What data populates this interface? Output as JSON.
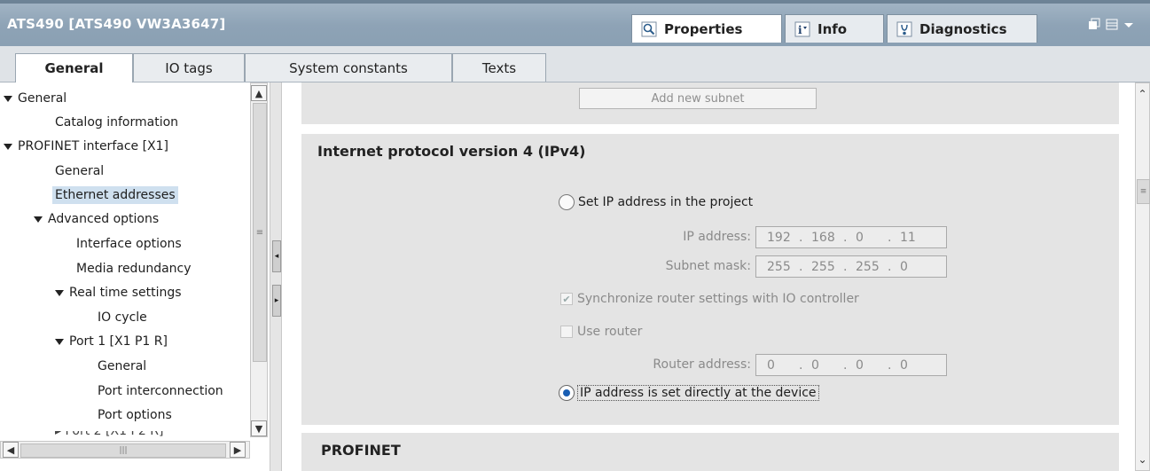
{
  "window": {
    "title": "ATS490 [ATS490 VW3A3647]",
    "tabs": [
      {
        "label": "Properties",
        "icon": "properties-magnifier-icon",
        "active": true
      },
      {
        "label": "Info",
        "icon": "info-icon",
        "active": false
      },
      {
        "label": "Diagnostics",
        "icon": "diagnostics-icon",
        "active": false
      }
    ],
    "window_controls_icon": "window-layout-icons"
  },
  "sub_tabs": [
    {
      "label": "General",
      "active": true
    },
    {
      "label": "IO tags",
      "active": false
    },
    {
      "label": "System constants",
      "active": false
    },
    {
      "label": "Texts",
      "active": false
    }
  ],
  "tree": [
    {
      "label": "General",
      "expanded": true,
      "level": 0
    },
    {
      "label": "Catalog information",
      "level": 1
    },
    {
      "label": "PROFINET interface [X1]",
      "expanded": true,
      "level": 0
    },
    {
      "label": "General",
      "level": 1
    },
    {
      "label": "Ethernet addresses",
      "level": 1,
      "selected": true
    },
    {
      "label": "Advanced options",
      "expanded": true,
      "level": 1
    },
    {
      "label": "Interface options",
      "level": 2
    },
    {
      "label": "Media redundancy",
      "level": 2
    },
    {
      "label": "Real time settings",
      "expanded": true,
      "level": 2
    },
    {
      "label": "IO cycle",
      "level": 3
    },
    {
      "label": "Port 1 [X1 P1 R]",
      "expanded": true,
      "level": 2
    },
    {
      "label": "General",
      "level": 3
    },
    {
      "label": "Port interconnection",
      "level": 3
    },
    {
      "label": "Port options",
      "level": 3
    }
  ],
  "main": {
    "add_subnet_button": "Add new subnet",
    "ipv4_heading": "Internet protocol version 4 (IPv4)",
    "radio_set_in_project": "Set IP address in the project",
    "ip_address_label": "IP address:",
    "ip_address": [
      "192",
      "168",
      "0",
      "11"
    ],
    "subnet_mask_label": "Subnet mask:",
    "subnet_mask": [
      "255",
      "255",
      "255",
      "0"
    ],
    "sync_router_label": "Synchronize router settings with IO controller",
    "sync_router_checked": true,
    "use_router_label": "Use router",
    "use_router_checked": false,
    "router_address_label": "Router address:",
    "router_address": [
      "0",
      "0",
      "0",
      "0"
    ],
    "radio_set_at_device": "IP address is set directly at the device",
    "selected_option": "set_at_device",
    "profinet_heading": "PROFINET"
  },
  "colors": {
    "title_bar": "#8ea3b6",
    "selection": "#cfe0ef",
    "section_bg": "#e4e4e4",
    "radio_dot": "#1a5fb4"
  }
}
